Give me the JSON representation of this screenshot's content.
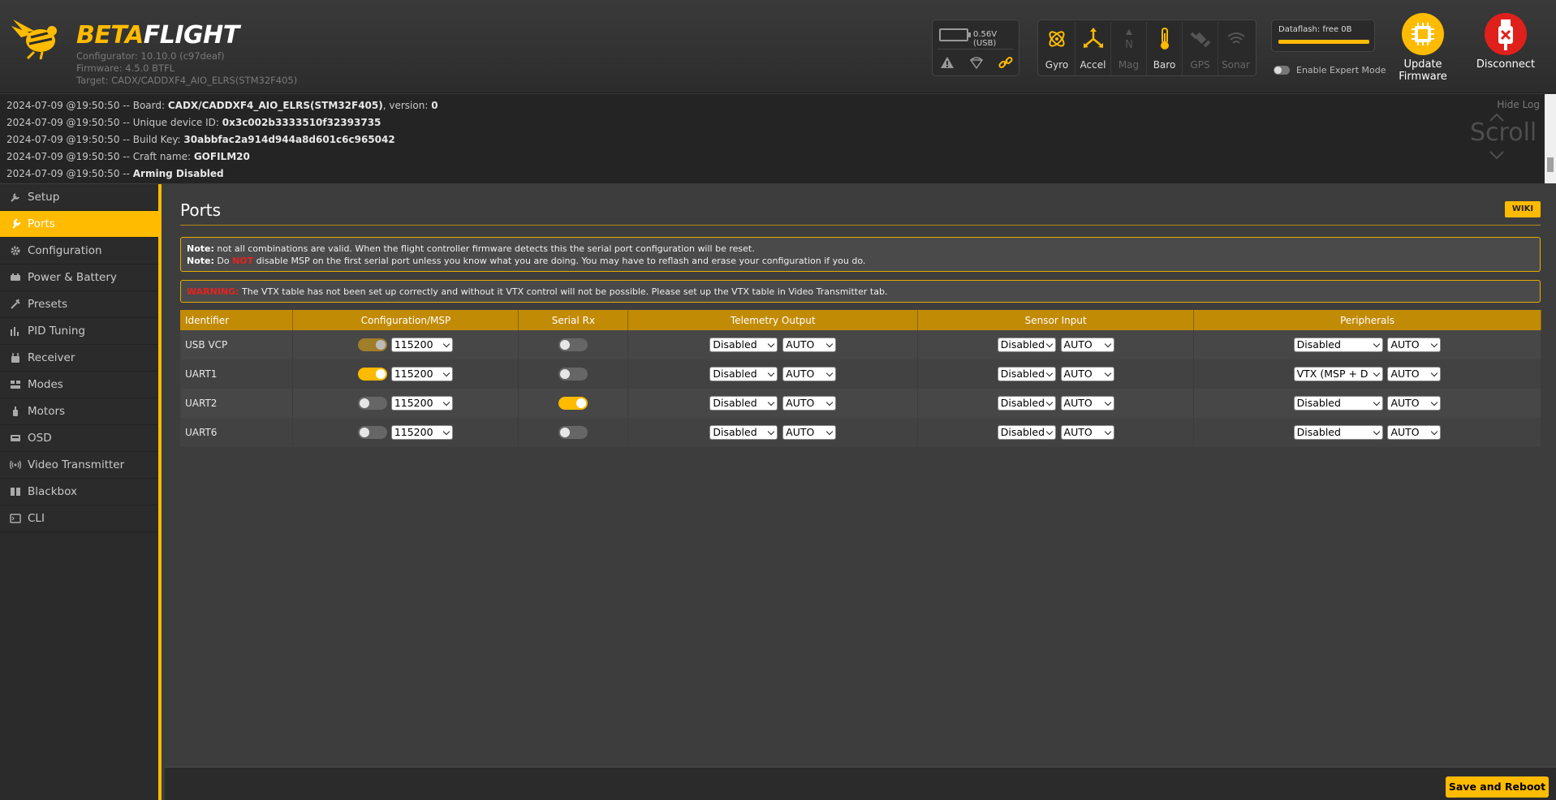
{
  "app": {
    "brand_a": "BETA",
    "brand_b": "FLIGHT",
    "configurator": "Configurator: 10.10.0 (c97deaf)",
    "firmware": "Firmware: 4.5.0 BTFL",
    "target": "Target: CADX/CADDXF4_AIO_ELRS(STM32F405)"
  },
  "status": {
    "battery": "0.56V (USB)",
    "sensors": [
      {
        "label": "Gyro",
        "icon": "gyro-icon",
        "active": true
      },
      {
        "label": "Accel",
        "icon": "accel-icon",
        "active": true
      },
      {
        "label": "Mag",
        "icon": "mag-icon",
        "active": false
      },
      {
        "label": "Baro",
        "icon": "baro-icon",
        "active": true
      },
      {
        "label": "GPS",
        "icon": "gps-icon",
        "active": false
      },
      {
        "label": "Sonar",
        "icon": "sonar-icon",
        "active": false
      }
    ],
    "dataflash": "Dataflash: free 0B",
    "expert_mode_label": "Enable Expert Mode",
    "update_firmware": "Update Firmware",
    "disconnect": "Disconnect"
  },
  "log": {
    "hide_label": "Hide Log",
    "scroll_label": "Scroll",
    "lines": [
      {
        "prefix": "2024-07-09 @19:50:50 -- Board: ",
        "value": "CADX/CADDXF4_AIO_ELRS(STM32F405)",
        "suffix": ", version: ",
        "value2": "0"
      },
      {
        "prefix": "2024-07-09 @19:50:50 -- Unique device ID: ",
        "value": "0x3c002b3333510f32393735",
        "suffix": "",
        "value2": ""
      },
      {
        "prefix": "2024-07-09 @19:50:50 -- Build Key: ",
        "value": "30abbfac2a914d944a8d601c6c965042",
        "suffix": "",
        "value2": ""
      },
      {
        "prefix": "2024-07-09 @19:50:50 -- Craft name: ",
        "value": "GOFILM20",
        "suffix": "",
        "value2": ""
      },
      {
        "prefix": "2024-07-09 @19:50:50 -- ",
        "value": "Arming Disabled",
        "suffix": "",
        "value2": ""
      }
    ]
  },
  "sidebar": {
    "items": [
      {
        "label": "Setup",
        "icon": "wrench-icon"
      },
      {
        "label": "Ports",
        "icon": "plug-icon",
        "active": true
      },
      {
        "label": "Configuration",
        "icon": "gear-icon"
      },
      {
        "label": "Power & Battery",
        "icon": "power-icon"
      },
      {
        "label": "Presets",
        "icon": "presets-icon"
      },
      {
        "label": "PID Tuning",
        "icon": "pid-icon"
      },
      {
        "label": "Receiver",
        "icon": "receiver-icon"
      },
      {
        "label": "Modes",
        "icon": "modes-icon"
      },
      {
        "label": "Motors",
        "icon": "motor-icon"
      },
      {
        "label": "OSD",
        "icon": "osd-icon"
      },
      {
        "label": "Video Transmitter",
        "icon": "vtx-icon"
      },
      {
        "label": "Blackbox",
        "icon": "blackbox-icon"
      },
      {
        "label": "CLI",
        "icon": "cli-icon"
      }
    ]
  },
  "page": {
    "title": "Ports",
    "wiki": "WIKI",
    "note1_label": "Note:",
    "note1_text": " not all combinations are valid. When the flight controller firmware detects this the serial port configuration will be reset.",
    "note2_label": "Note:",
    "note2_pre": " Do ",
    "note2_not": "NOT",
    "note2_post": " disable MSP on the first serial port unless you know what you are doing. You may have to reflash and erase your configuration if you do.",
    "warning_label": "WARNING:",
    "warning_text": " The VTX table has not been set up correctly and without it VTX control will not be possible. Please set up the VTX table in Video Transmitter tab."
  },
  "table": {
    "headers": [
      "Identifier",
      "Configuration/MSP",
      "Serial Rx",
      "Telemetry Output",
      "Sensor Input",
      "Peripherals"
    ],
    "rows": [
      {
        "id": "USB VCP",
        "msp": "dim",
        "baud": "115200",
        "rx": false,
        "tel": "Disabled",
        "tel_auto": "AUTO",
        "sens": "Disabled",
        "sens_auto": "AUTO",
        "per": "Disabled",
        "per_auto": "AUTO"
      },
      {
        "id": "UART1",
        "msp": "on",
        "baud": "115200",
        "rx": false,
        "tel": "Disabled",
        "tel_auto": "AUTO",
        "sens": "Disabled",
        "sens_auto": "AUTO",
        "per": "VTX (MSP + D",
        "per_auto": "AUTO"
      },
      {
        "id": "UART2",
        "msp": "off",
        "baud": "115200",
        "rx": true,
        "tel": "Disabled",
        "tel_auto": "AUTO",
        "sens": "Disabled",
        "sens_auto": "AUTO",
        "per": "Disabled",
        "per_auto": "AUTO"
      },
      {
        "id": "UART6",
        "msp": "off",
        "baud": "115200",
        "rx": false,
        "tel": "Disabled",
        "tel_auto": "AUTO",
        "sens": "Disabled",
        "sens_auto": "AUTO",
        "per": "Disabled",
        "per_auto": "AUTO"
      }
    ]
  },
  "footer": {
    "save_reboot": "Save and Reboot"
  },
  "colors": {
    "accent": "#ffbb00",
    "disconnect": "#e0201b",
    "warning": "#e8221e"
  }
}
